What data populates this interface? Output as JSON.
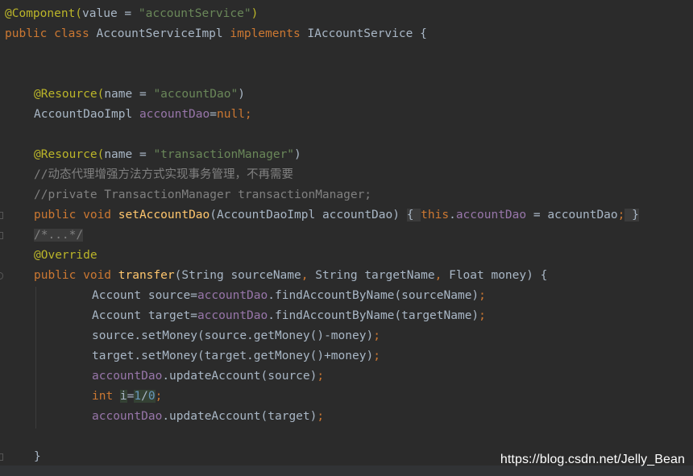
{
  "editor": {
    "lines": [
      {
        "indent": 0,
        "marker": "",
        "tokens": [
          {
            "t": "@Component(",
            "c": "annotation"
          },
          {
            "t": "value",
            "c": "plain"
          },
          {
            "t": " = ",
            "c": "plain"
          },
          {
            "t": "\"accountService\"",
            "c": "string"
          },
          {
            "t": ")",
            "c": "annotation"
          }
        ]
      },
      {
        "indent": 0,
        "marker": "",
        "tokens": [
          {
            "t": "public class ",
            "c": "keyword"
          },
          {
            "t": "AccountServiceImpl ",
            "c": "plain"
          },
          {
            "t": "implements ",
            "c": "keyword"
          },
          {
            "t": "IAccountService {",
            "c": "plain"
          }
        ]
      },
      {
        "indent": 0,
        "marker": "",
        "tokens": []
      },
      {
        "indent": 0,
        "marker": "",
        "tokens": []
      },
      {
        "indent": 1,
        "marker": "",
        "tokens": [
          {
            "t": "@Resource(",
            "c": "annotation"
          },
          {
            "t": "name",
            "c": "plain"
          },
          {
            "t": " = ",
            "c": "plain"
          },
          {
            "t": "\"accountDao\"",
            "c": "string"
          },
          {
            "t": ")",
            "c": "plain"
          }
        ]
      },
      {
        "indent": 1,
        "marker": "",
        "tokens": [
          {
            "t": "AccountDaoImpl ",
            "c": "plain"
          },
          {
            "t": "accountDao",
            "c": "field"
          },
          {
            "t": "=",
            "c": "plain"
          },
          {
            "t": "null;",
            "c": "keyword"
          }
        ]
      },
      {
        "indent": 0,
        "marker": "",
        "tokens": []
      },
      {
        "indent": 1,
        "marker": "",
        "tokens": [
          {
            "t": "@Resource(",
            "c": "annotation"
          },
          {
            "t": "name",
            "c": "plain"
          },
          {
            "t": " = ",
            "c": "plain"
          },
          {
            "t": "\"transactionManager\"",
            "c": "string"
          },
          {
            "t": ")",
            "c": "plain"
          }
        ]
      },
      {
        "indent": 1,
        "marker": "",
        "tokens": [
          {
            "t": "//动态代理增强方法方式实现事务管理，不再需要",
            "c": "comment"
          }
        ]
      },
      {
        "indent": 1,
        "marker": "",
        "tokens": [
          {
            "t": "//private TransactionManager transactionManager;",
            "c": "comment"
          }
        ]
      },
      {
        "indent": 1,
        "marker": "fold",
        "tokens": [
          {
            "t": "public void ",
            "c": "keyword"
          },
          {
            "t": "setAccountDao",
            "c": "method-decl-dim"
          },
          {
            "t": "(AccountDaoImpl accountDao) ",
            "c": "plain"
          },
          {
            "t": "{ ",
            "c": "brace-fold"
          },
          {
            "t": "this",
            "c": "keyword"
          },
          {
            "t": ".",
            "c": "plain"
          },
          {
            "t": "accountDao",
            "c": "field"
          },
          {
            "t": " = accountDao",
            "c": "plain"
          },
          {
            "t": ";",
            "c": "keyword"
          },
          {
            "t": " }",
            "c": "brace-fold"
          }
        ]
      },
      {
        "indent": 1,
        "marker": "fold",
        "tokens": [
          {
            "t": "/*...*/",
            "c": "comment-folded"
          }
        ]
      },
      {
        "indent": 1,
        "marker": "",
        "tokens": [
          {
            "t": "@Override",
            "c": "annotation"
          }
        ]
      },
      {
        "indent": 1,
        "marker": "override",
        "tokens": [
          {
            "t": "public void ",
            "c": "keyword"
          },
          {
            "t": "transfer",
            "c": "method-decl"
          },
          {
            "t": "(String sourceName",
            "c": "plain"
          },
          {
            "t": ", ",
            "c": "keyword"
          },
          {
            "t": "String targetName",
            "c": "plain"
          },
          {
            "t": ", ",
            "c": "keyword"
          },
          {
            "t": "Float money) {",
            "c": "plain"
          }
        ]
      },
      {
        "indent": 2,
        "marker": "",
        "tokens": [
          {
            "t": "Account source=",
            "c": "plain"
          },
          {
            "t": "accountDao",
            "c": "field"
          },
          {
            "t": ".findAccountByName(sourceName)",
            "c": "plain"
          },
          {
            "t": ";",
            "c": "keyword"
          }
        ]
      },
      {
        "indent": 2,
        "marker": "",
        "tokens": [
          {
            "t": "Account target=",
            "c": "plain"
          },
          {
            "t": "accountDao",
            "c": "field"
          },
          {
            "t": ".findAccountByName(targetName)",
            "c": "plain"
          },
          {
            "t": ";",
            "c": "keyword"
          }
        ]
      },
      {
        "indent": 2,
        "marker": "",
        "tokens": [
          {
            "t": "source.setMoney(source.getMoney()-money)",
            "c": "plain"
          },
          {
            "t": ";",
            "c": "keyword"
          }
        ]
      },
      {
        "indent": 2,
        "marker": "",
        "tokens": [
          {
            "t": "target.setMoney(target.getMoney()+money)",
            "c": "plain"
          },
          {
            "t": ";",
            "c": "keyword"
          }
        ]
      },
      {
        "indent": 2,
        "marker": "",
        "tokens": [
          {
            "t": "accountDao",
            "c": "field"
          },
          {
            "t": ".updateAccount(source)",
            "c": "plain"
          },
          {
            "t": ";",
            "c": "keyword"
          }
        ]
      },
      {
        "indent": 2,
        "marker": "",
        "tokens": [
          {
            "t": "int ",
            "c": "keyword"
          },
          {
            "t": "i",
            "c": "plain-hl"
          },
          {
            "t": "=",
            "c": "plain"
          },
          {
            "t": "1",
            "c": "number-hl"
          },
          {
            "t": "/",
            "c": "plain-hl"
          },
          {
            "t": "0",
            "c": "number-hl"
          },
          {
            "t": ";",
            "c": "keyword"
          }
        ]
      },
      {
        "indent": 2,
        "marker": "",
        "tokens": [
          {
            "t": "accountDao",
            "c": "field"
          },
          {
            "t": ".updateAccount(target)",
            "c": "plain"
          },
          {
            "t": ";",
            "c": "keyword"
          }
        ]
      },
      {
        "indent": 0,
        "marker": "",
        "tokens": []
      },
      {
        "indent": 1,
        "marker": "fold",
        "tokens": [
          {
            "t": "}",
            "c": "plain"
          }
        ]
      }
    ]
  },
  "watermark": {
    "text": "https://blog.csdn.net/Jelly_Bean"
  },
  "colors": {
    "background": "#2b2b2b",
    "annotation": "#bbb529",
    "keyword": "#cc7832",
    "string": "#6a8759",
    "field": "#9876aa",
    "method_declaration": "#ffc66d",
    "comment": "#808080",
    "plain": "#a9b7c6",
    "number": "#6897bb"
  }
}
